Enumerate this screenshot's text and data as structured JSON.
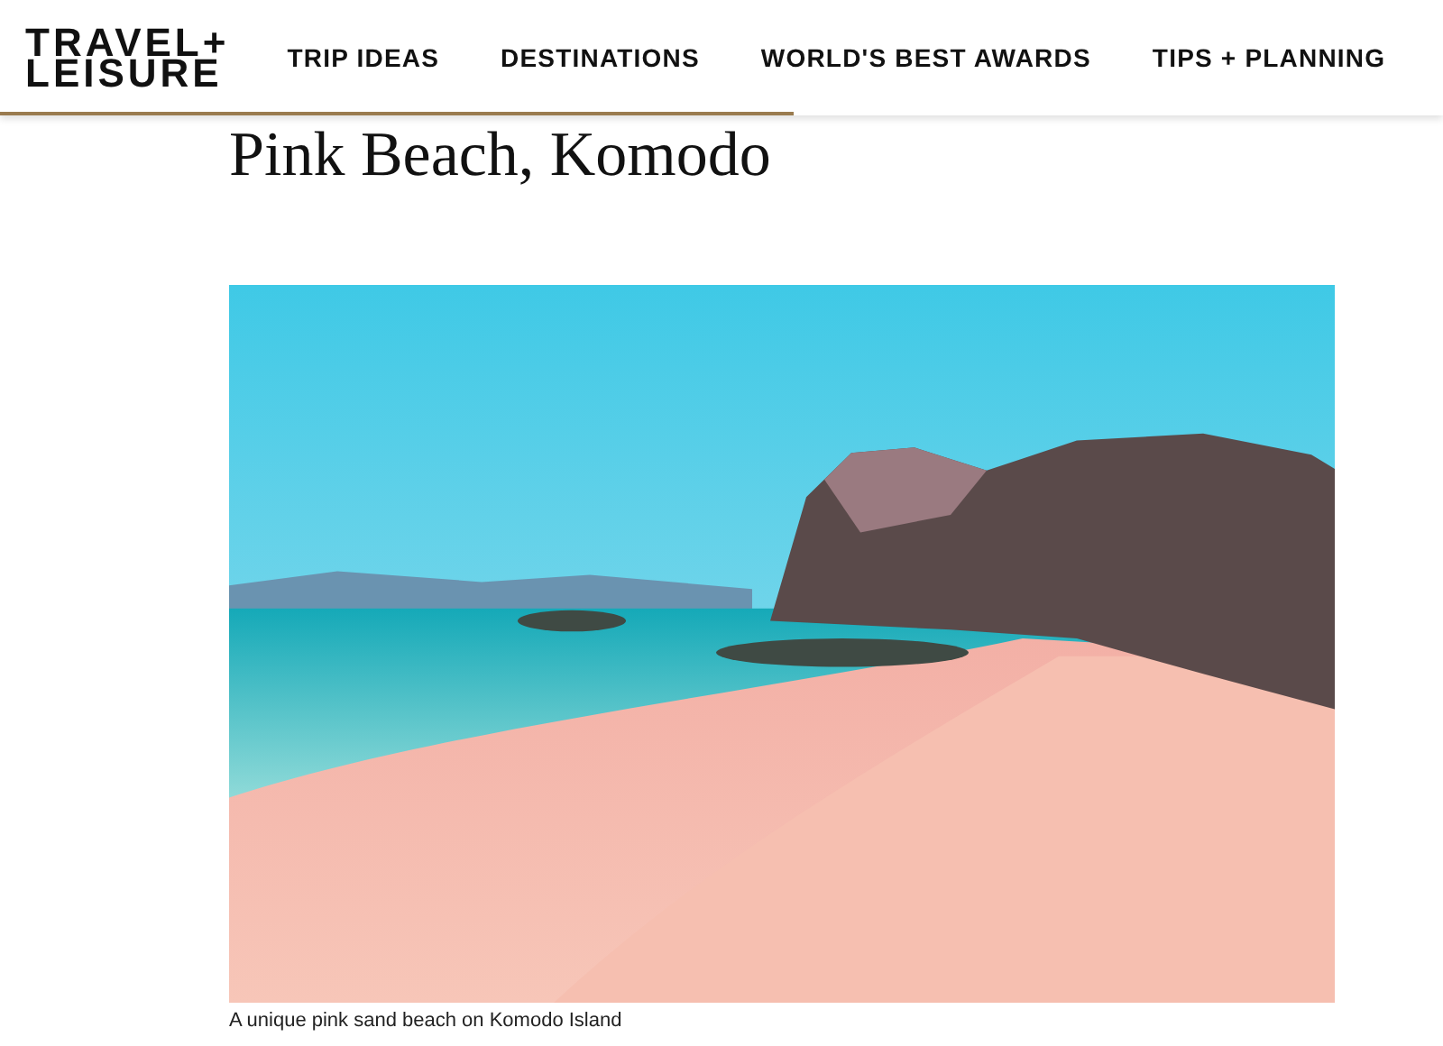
{
  "header": {
    "logo": {
      "line_1": "TRAVEL+",
      "line_2": "LEISURE"
    },
    "nav": [
      {
        "label": "TRIP IDEAS"
      },
      {
        "label": "DESTINATIONS"
      },
      {
        "label": "WORLD'S BEST AWARDS"
      },
      {
        "label": "TIPS + PLANNING"
      }
    ]
  },
  "article": {
    "title": "Pink Beach, Komodo",
    "image_caption": "A unique pink sand beach on Komodo Island"
  }
}
